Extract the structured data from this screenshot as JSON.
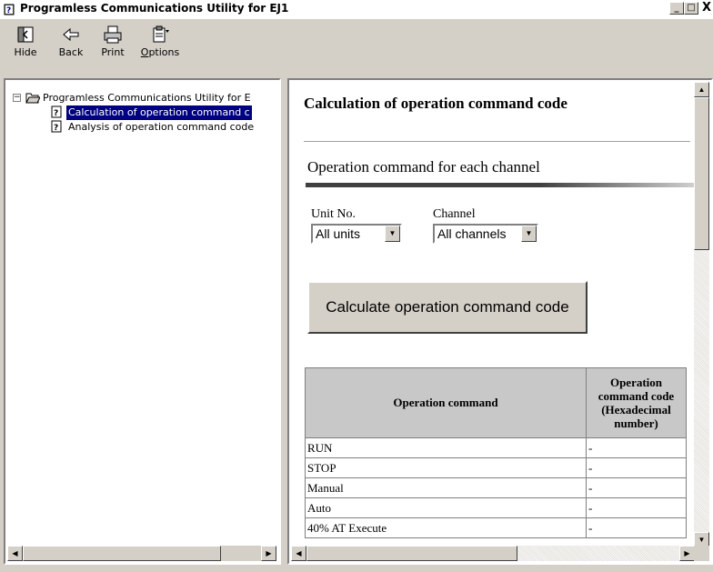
{
  "window": {
    "title": "Programless Communications Utility for EJ1",
    "controls": [
      "_",
      "□",
      "X"
    ]
  },
  "toolbar": {
    "hide": "Hide",
    "back": "Back",
    "print": "Print",
    "options": "Options"
  },
  "tree": {
    "root": "Programless Communications Utility for E",
    "items": [
      {
        "label": "Calculation of operation command c",
        "selected": true
      },
      {
        "label": "Analysis of operation command code",
        "selected": false
      }
    ]
  },
  "page": {
    "heading": "Calculation of operation command code",
    "section": "Operation command for each channel",
    "unit_label": "Unit No.",
    "unit_value": "All units",
    "channel_label": "Channel",
    "channel_value": "All channels",
    "calc_button": "Calculate operation command code"
  },
  "table": {
    "headers": [
      "Operation command",
      "Operation command code (Hexadecimal number)"
    ],
    "rows": [
      [
        "RUN",
        "-"
      ],
      [
        "STOP",
        "-"
      ],
      [
        "Manual",
        "-"
      ],
      [
        "Auto",
        "-"
      ],
      [
        "40% AT Execute",
        "-"
      ]
    ]
  },
  "colors": {
    "selection": "#000080",
    "chrome": "#d4d0c8",
    "header_cell": "#c8c8c8"
  }
}
